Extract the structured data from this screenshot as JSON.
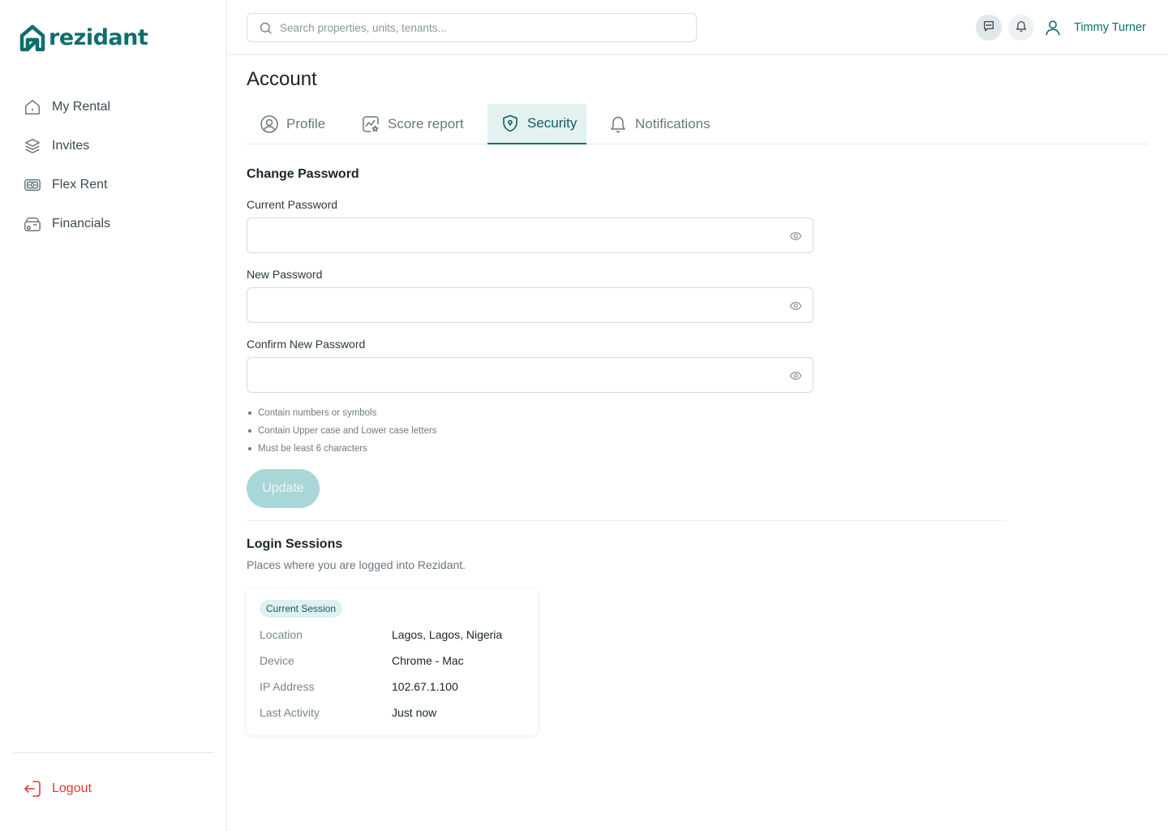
{
  "brand": {
    "name": "rezidant",
    "color": "#0e6e6e"
  },
  "sidebar": {
    "items": [
      {
        "label": "My Rental",
        "icon": "home-icon"
      },
      {
        "label": "Invites",
        "icon": "layers-icon"
      },
      {
        "label": "Flex Rent",
        "icon": "money-icon"
      },
      {
        "label": "Financials",
        "icon": "wallet-icon"
      }
    ],
    "logout": {
      "label": "Logout",
      "icon": "logout-icon",
      "color": "#e03a2f"
    }
  },
  "header": {
    "search_placeholder": "Search properties, units, tenants...",
    "user_name": "Timmy Turner"
  },
  "page": {
    "title": "Account",
    "tabs": [
      {
        "label": "Profile",
        "icon": "user-circle-icon",
        "active": false
      },
      {
        "label": "Score report",
        "icon": "chart-star-icon",
        "active": false
      },
      {
        "label": "Security",
        "icon": "shield-icon",
        "active": true
      },
      {
        "label": "Notifications",
        "icon": "bell-icon",
        "active": false
      }
    ]
  },
  "change_password": {
    "title": "Change Password",
    "current_label": "Current Password",
    "new_label": "New Password",
    "confirm_label": "Confirm New Password",
    "rules": [
      "Contain numbers or symbols",
      "Contain Upper case and Lower case letters",
      "Must be least 6 characters"
    ],
    "update_label": "Update"
  },
  "sessions": {
    "title": "Login Sessions",
    "subtitle": "Places where you are logged into Rezidant.",
    "badge": "Current Session",
    "rows": [
      {
        "key": "Location",
        "value": "Lagos, Lagos, Nigeria"
      },
      {
        "key": "Device",
        "value": "Chrome - Mac"
      },
      {
        "key": "IP Address",
        "value": "102.67.1.100"
      },
      {
        "key": "Last Activity",
        "value": "Just now"
      }
    ]
  }
}
